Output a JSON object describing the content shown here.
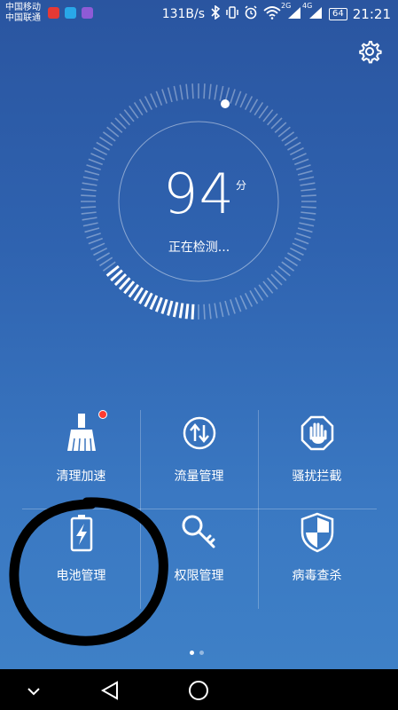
{
  "status_bar": {
    "carrier_1": "中国移动",
    "carrier_2": "中国联通",
    "speed": "131B/s",
    "net_1": "2G",
    "net_2": "4G",
    "battery": "64",
    "time": "21:21"
  },
  "score": {
    "value": "94",
    "unit": "分",
    "status": "正在检测..."
  },
  "features": [
    {
      "label": "清理加速",
      "icon": "broom-icon"
    },
    {
      "label": "流量管理",
      "icon": "data-traffic-icon"
    },
    {
      "label": "骚扰拦截",
      "icon": "hand-block-icon"
    },
    {
      "label": "电池管理",
      "icon": "battery-icon"
    },
    {
      "label": "权限管理",
      "icon": "key-icon"
    },
    {
      "label": "病毒查杀",
      "icon": "shield-icon"
    }
  ],
  "page_indicator": {
    "count": 2,
    "active": 1
  },
  "colors": {
    "background_top": "#2a55a0",
    "background_bottom": "#3f82c8",
    "badge": "#ff3b30",
    "annotation": "#000000"
  }
}
